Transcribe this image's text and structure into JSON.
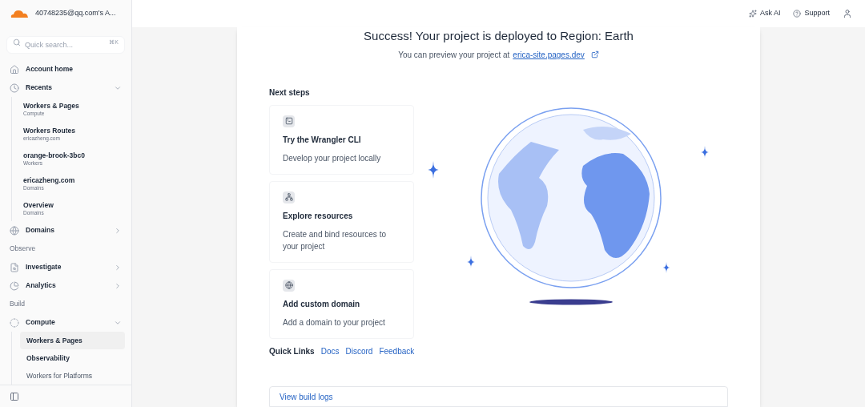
{
  "account": {
    "name": "40748235@qq.com's A..."
  },
  "search": {
    "placeholder": "Quick search...",
    "shortcut": "⌘K"
  },
  "sidebar": {
    "items": [
      {
        "kind": "link",
        "label": "Account home"
      },
      {
        "kind": "group",
        "label": "Recents",
        "expanded": true,
        "children": [
          {
            "label": "Workers & Pages",
            "sub": "Compute",
            "selected": false
          },
          {
            "label": "Workers Routes",
            "sub": "ericazheng.com",
            "selected": false
          },
          {
            "label": "orange-brook-3bc0",
            "sub": "Workers",
            "selected": false
          },
          {
            "label": "ericazheng.com",
            "sub": "Domains",
            "selected": false
          },
          {
            "label": "Overview",
            "sub": "Domains",
            "selected": false
          }
        ]
      },
      {
        "kind": "group",
        "label": "Domains",
        "expanded": false
      },
      {
        "kind": "section",
        "label": "Observe"
      },
      {
        "kind": "group",
        "label": "Investigate",
        "expanded": false
      },
      {
        "kind": "group",
        "label": "Analytics",
        "expanded": false
      },
      {
        "kind": "section",
        "label": "Build"
      },
      {
        "kind": "group",
        "label": "Compute",
        "expanded": true,
        "children": [
          {
            "label": "Workers & Pages",
            "selected": true
          },
          {
            "label": "Observability",
            "selected": false
          },
          {
            "label": "Workers for Platforms",
            "selected": false
          }
        ]
      }
    ]
  },
  "header": {
    "actions": [
      "Ask AI",
      "Support"
    ]
  },
  "main": {
    "title": "Success! Your project is deployed to Region: Earth",
    "preview_text": "You can preview your project at",
    "preview_link": "erica-site.pages.dev",
    "next_steps_heading": "Next steps",
    "steps": [
      {
        "title": "Try the Wrangler CLI",
        "description": "Develop your project locally"
      },
      {
        "title": "Explore resources",
        "description": "Create and bind resources to your project"
      },
      {
        "title": "Add custom domain",
        "description": "Add a domain to your project"
      }
    ],
    "quick_links_label": "Quick Links",
    "quick_links": [
      "Docs",
      "Discord",
      "Feedback"
    ],
    "build_logs": "View build logs"
  }
}
